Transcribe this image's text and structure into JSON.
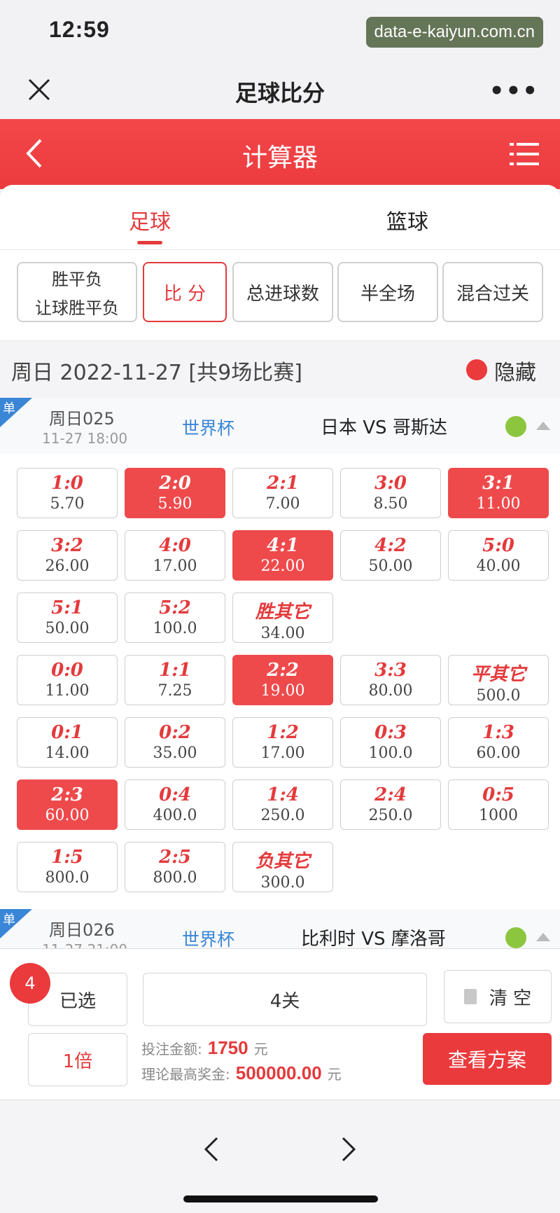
{
  "status_bar": {
    "time": "12:59",
    "watermark": "data-e-kaiyun.com.cn"
  },
  "nav": {
    "title": "足球比分",
    "more": "•••"
  },
  "header": {
    "title": "计算器"
  },
  "sport_tabs": [
    {
      "label": "足球",
      "active": true
    },
    {
      "label": "篮球",
      "active": false
    }
  ],
  "play_tabs": [
    {
      "line1": "胜平负",
      "line2": "让球胜平负"
    },
    {
      "label": "比 分",
      "active": true
    },
    {
      "label": "总进球数"
    },
    {
      "label": "半全场"
    },
    {
      "label": "混合过关"
    }
  ],
  "date_bar": {
    "text": "周日 2022-11-27 [共9场比赛]",
    "hide_label": "隐藏"
  },
  "matches": [
    {
      "corner": "单",
      "no": "周日025",
      "time": "11-27 18:00",
      "league": "世界杯",
      "teams": "日本 VS 哥斯达"
    },
    {
      "corner": "单",
      "no": "周日026",
      "time": "11-27 21:00",
      "league": "世界杯",
      "teams": "比利时 VS 摩洛哥"
    }
  ],
  "score_odds": [
    {
      "score": "1:0",
      "odds": "5.70",
      "selected": false
    },
    {
      "score": "2:0",
      "odds": "5.90",
      "selected": true
    },
    {
      "score": "2:1",
      "odds": "7.00",
      "selected": false
    },
    {
      "score": "3:0",
      "odds": "8.50",
      "selected": false
    },
    {
      "score": "3:1",
      "odds": "11.00",
      "selected": true
    },
    {
      "score": "3:2",
      "odds": "26.00",
      "selected": false
    },
    {
      "score": "4:0",
      "odds": "17.00",
      "selected": false
    },
    {
      "score": "4:1",
      "odds": "22.00",
      "selected": true
    },
    {
      "score": "4:2",
      "odds": "50.00",
      "selected": false
    },
    {
      "score": "5:0",
      "odds": "40.00",
      "selected": false
    },
    {
      "score": "5:1",
      "odds": "50.00",
      "selected": false
    },
    {
      "score": "5:2",
      "odds": "100.0",
      "selected": false
    },
    {
      "score": "胜其它",
      "odds": "34.00",
      "selected": false
    },
    {
      "score": "0:0",
      "odds": "11.00",
      "selected": false
    },
    {
      "score": "1:1",
      "odds": "7.25",
      "selected": false
    },
    {
      "score": "2:2",
      "odds": "19.00",
      "selected": true
    },
    {
      "score": "3:3",
      "odds": "80.00",
      "selected": false
    },
    {
      "score": "平其它",
      "odds": "500.0",
      "selected": false
    },
    {
      "score": "0:1",
      "odds": "14.00",
      "selected": false
    },
    {
      "score": "0:2",
      "odds": "35.00",
      "selected": false
    },
    {
      "score": "1:2",
      "odds": "17.00",
      "selected": false
    },
    {
      "score": "0:3",
      "odds": "100.0",
      "selected": false
    },
    {
      "score": "1:3",
      "odds": "60.00",
      "selected": false
    },
    {
      "score": "2:3",
      "odds": "60.00",
      "selected": true
    },
    {
      "score": "0:4",
      "odds": "400.0",
      "selected": false
    },
    {
      "score": "1:4",
      "odds": "250.0",
      "selected": false
    },
    {
      "score": "2:4",
      "odds": "250.0",
      "selected": false
    },
    {
      "score": "0:5",
      "odds": "1000",
      "selected": false
    },
    {
      "score": "1:5",
      "odds": "800.0",
      "selected": false
    },
    {
      "score": "2:5",
      "odds": "800.0",
      "selected": false
    },
    {
      "score": "负其它",
      "odds": "300.0",
      "selected": false
    }
  ],
  "bottom": {
    "selected_count": "4",
    "selected_label": "已选",
    "pass_label": "4关",
    "clear_label": "清 空",
    "multiple_label": "1倍",
    "bet_amount_label": "投注金额:",
    "bet_amount_value": "1750",
    "bet_amount_unit": "元",
    "max_prize_label": "理论最高奖金:",
    "max_prize_value": "500000.00",
    "max_prize_unit": "元",
    "view_button": "查看方案"
  },
  "colors": {
    "accent": "#e43a3c",
    "selected_cell": "#ee4a4c",
    "league_blue": "#3a86d6",
    "check_green": "#8cc63f"
  }
}
